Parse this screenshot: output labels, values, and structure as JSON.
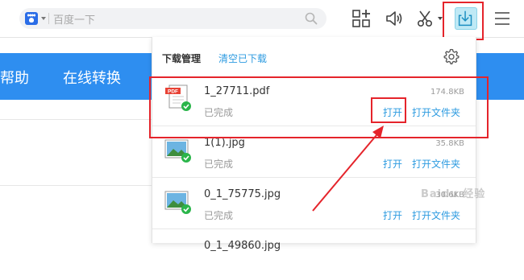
{
  "toolbar": {
    "search_placeholder": "百度一下",
    "search_engine_icon": "baidu-paw-icon",
    "icons": [
      "apps-grid-icon",
      "volume-icon",
      "scissors-icon",
      "download-icon",
      "menu-icon"
    ]
  },
  "page": {
    "nav_items": [
      "帮助",
      "在线转换"
    ],
    "nav_color": "#2e8ef0"
  },
  "panel": {
    "title": "下载管理",
    "clear_link": "清空已下载",
    "items": [
      {
        "name": "1_27711.pdf",
        "status": "已完成",
        "size": "174.8KB",
        "open": "打开",
        "open_folder": "打开文件夹",
        "icon": "pdf-file-icon"
      },
      {
        "name": "1(1).jpg",
        "status": "已完成",
        "size": "35.8KB",
        "open": "打开",
        "open_folder": "打开文件夹",
        "icon": "image-file-icon"
      },
      {
        "name": "0_1_75775.jpg",
        "status": "已完成",
        "size": "30.6KB",
        "open": "打开",
        "open_folder": "打开文件夹",
        "icon": "image-file-icon"
      },
      {
        "name": "0_1_49860.jpg",
        "status": "",
        "size": "",
        "open": "",
        "open_folder": "",
        "icon": "image-file-icon"
      }
    ]
  },
  "watermark": "Baidu 经验",
  "colors": {
    "accent": "#2d9be0",
    "annotation": "#e5242b"
  }
}
